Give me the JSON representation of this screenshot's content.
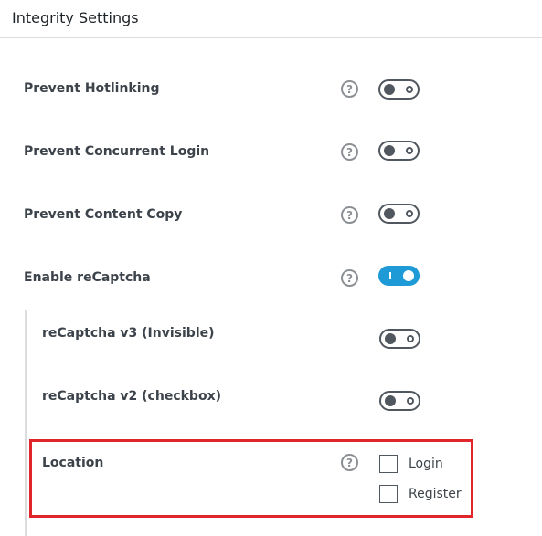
{
  "header": {
    "title": "Integrity Settings"
  },
  "settings": [
    {
      "label": "Prevent Hotlinking",
      "help": "?",
      "enabled": false
    },
    {
      "label": "Prevent Concurrent Login",
      "help": "?",
      "enabled": false
    },
    {
      "label": "Prevent Content Copy",
      "help": "?",
      "enabled": false
    },
    {
      "label": "Enable reCaptcha",
      "help": "?",
      "enabled": true
    }
  ],
  "recaptcha": {
    "v3": {
      "label": "reCaptcha v3 (Invisible)",
      "enabled": false
    },
    "v2": {
      "label": "reCaptcha v2 (checkbox)",
      "enabled": false
    },
    "location": {
      "label": "Location",
      "help": "?",
      "options": [
        {
          "label": "Login",
          "checked": false
        },
        {
          "label": "Register",
          "checked": false
        }
      ]
    }
  },
  "colors": {
    "highlight_border": "#e0262b",
    "toggle_on": "#1e9ad6"
  }
}
